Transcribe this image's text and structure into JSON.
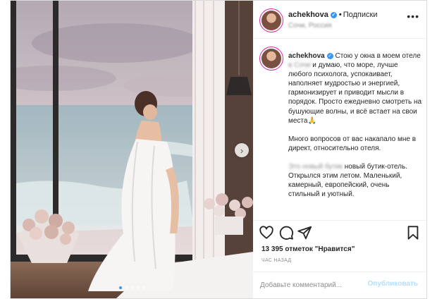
{
  "post": {
    "image_alt": "",
    "carousel": {
      "dot_count": 5,
      "active_index": 0,
      "next_icon": "chevron-right-icon"
    }
  },
  "header": {
    "username": "achekhova",
    "separator": "•",
    "follow_label": "Подписки",
    "location": "Сочи, Россия",
    "more_icon": "more-horizontal-icon"
  },
  "caption": {
    "username": "achekhova",
    "line_1_start": "Стою у окна в моем отеле",
    "line_1_redacted": "в Сочи",
    "body_1": "и думаю, что море, лучше любого психолога, успокаивает, наполняет мудростью и энергией, гармонизирует и приводит мысли в порядок. Просто ежедневно смотреть на бушующие волны, и всё встает на свои места🙏",
    "body_2": "Много вопросов от вас накапало мне в директ, относительно отеля.",
    "body_3_redacted": "Это новый бутик",
    "body_3": "новый бутик-отель. Открылся этим летом. Маленький, камерный, европейский, очень стильный и уютный."
  },
  "actions": {
    "like_icon": "heart-icon",
    "comment_icon": "comment-icon",
    "share_icon": "paper-plane-icon",
    "save_icon": "bookmark-icon"
  },
  "likes": "13 395 отметок \"Нравится\"",
  "timestamp": "ЧАС НАЗАД",
  "comment": {
    "placeholder": "Добавьте комментарий...",
    "publish_label": "Опубликовать",
    "publish_color": "#b2dffc"
  },
  "colors": {
    "verified": "#3897f0",
    "active_dot": "#3897f0",
    "secondary_text": "#8e8e8e",
    "border": "#dbdbdb"
  }
}
